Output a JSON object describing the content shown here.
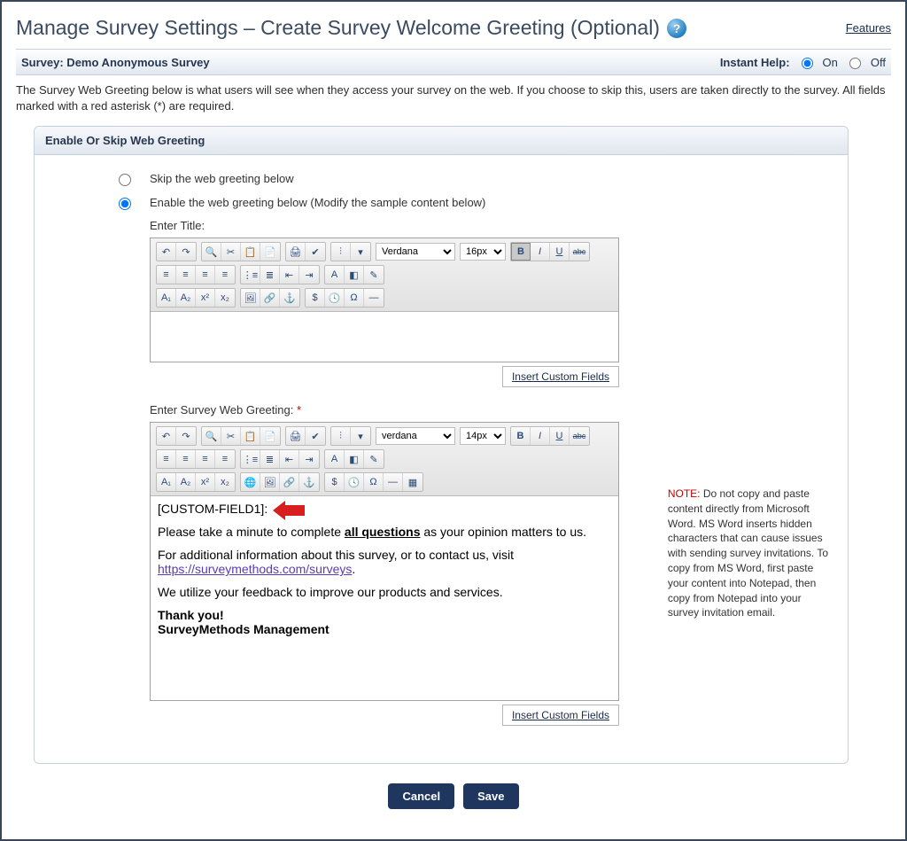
{
  "header": {
    "title": "Manage Survey Settings – Create Survey Welcome Greeting (Optional)",
    "features_link": "Features"
  },
  "subheader": {
    "survey_label": "Survey: Demo Anonymous Survey",
    "instant_help_label": "Instant Help:",
    "on_label": "On",
    "off_label": "Off"
  },
  "description": "The Survey Web Greeting below is what users will see when they access your survey on the web. If you choose to skip this, users are taken directly to the survey. All fields marked with a red asterisk (*) are required.",
  "panel": {
    "header": "Enable Or Skip Web Greeting",
    "radio_skip": "Skip the web greeting below",
    "radio_enable": "Enable the web greeting below (Modify the sample content below)",
    "title_label": "Enter Title:",
    "greeting_label": "Enter Survey Web Greeting:",
    "insert_cf": "Insert Custom Fields"
  },
  "editor1": {
    "font_name": "Verdana",
    "font_size": "16px",
    "content": ""
  },
  "editor2": {
    "font_name": "verdana",
    "font_size": "14px",
    "content": {
      "line1": "[CUSTOM-FIELD1]:",
      "para1_a": "Please take a minute to complete ",
      "para1_b_uline": "all questions",
      "para1_c": " as your opinion matters to us.",
      "para2_a": "For additional information about this survey, or to contact us, visit ",
      "para2_link": "https://surveymethods.com/surveys",
      "para2_c": ".",
      "para3": "We utilize your feedback to improve our products and services.",
      "sig1": "Thank you!",
      "sig2": "SurveyMethods Management"
    }
  },
  "sidebar_note": {
    "label": "NOTE:",
    "text": " Do not copy and paste content directly from Microsoft Word. MS Word inserts hidden characters that can cause issues with sending survey invitations. To copy from MS Word, first paste your content into Notepad, then copy from Notepad into your survey invitation email."
  },
  "buttons": {
    "cancel": "Cancel",
    "save": "Save"
  },
  "toolbar_icons": {
    "row1": [
      "↶",
      "↷",
      "⌕",
      "✂",
      "📋",
      "📄",
      "🖨",
      "✔",
      "⫶",
      "·"
    ],
    "row1b_style": [
      "B",
      "I",
      "U",
      "abc"
    ],
    "row2a": [
      "≡",
      "≡",
      "≡",
      "≡",
      "≣",
      "≣",
      "⋮≡",
      "⋮≡",
      "⇤",
      "⇥",
      "A",
      "◧",
      "✎"
    ],
    "row3a": [
      "A₁",
      "A₂",
      "x²",
      "x₂",
      "🌐",
      "🔗",
      "⚓",
      "$",
      "🕓",
      "Ω",
      "≡"
    ]
  }
}
